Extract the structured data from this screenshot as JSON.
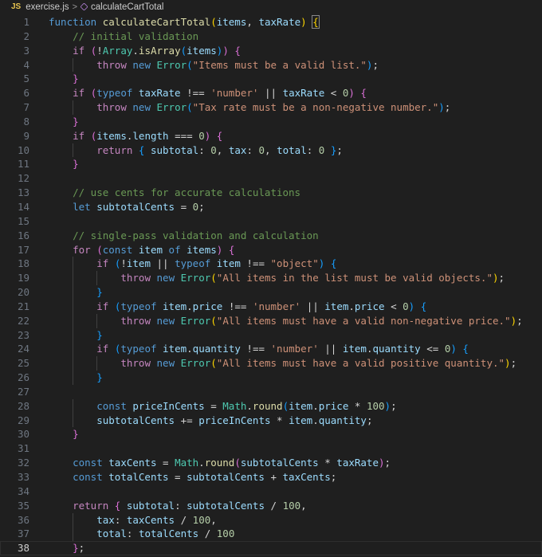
{
  "breadcrumb": {
    "file_badge": "JS",
    "file_name": "exercise.js",
    "separator": ">",
    "symbol_name": "calculateCartTotal"
  },
  "colors": {
    "background": "#1f1f1f",
    "keyword": "#569cd6",
    "control": "#c586c0",
    "function": "#dcdcaa",
    "variable": "#9cdcfe",
    "class": "#4ec9b0",
    "string": "#ce9178",
    "number": "#b5cea8",
    "comment": "#6a9955"
  },
  "editor": {
    "current_line": 38,
    "lines": [
      {
        "n": 1,
        "indent": 0,
        "t": [
          [
            "kw",
            "function "
          ],
          [
            "fn",
            "calculateCartTotal"
          ],
          [
            "br1",
            "("
          ],
          [
            "var",
            "items"
          ],
          [
            "op",
            ", "
          ],
          [
            "var",
            "taxRate"
          ],
          [
            "br1",
            ")"
          ],
          [
            "op",
            " "
          ],
          [
            "br1",
            "{"
          ]
        ]
      },
      {
        "n": 2,
        "indent": 1,
        "t": [
          [
            "cmt",
            "// initial validation"
          ]
        ]
      },
      {
        "n": 3,
        "indent": 1,
        "t": [
          [
            "ctl",
            "if "
          ],
          [
            "br2",
            "("
          ],
          [
            "op",
            "!"
          ],
          [
            "cls",
            "Array"
          ],
          [
            "op",
            "."
          ],
          [
            "fn",
            "isArray"
          ],
          [
            "br3",
            "("
          ],
          [
            "var",
            "items"
          ],
          [
            "br3",
            ")"
          ],
          [
            "br2",
            ")"
          ],
          [
            "op",
            " "
          ],
          [
            "br2",
            "{"
          ]
        ]
      },
      {
        "n": 4,
        "indent": 2,
        "t": [
          [
            "ctl",
            "throw "
          ],
          [
            "kw",
            "new "
          ],
          [
            "cls",
            "Error"
          ],
          [
            "br3",
            "("
          ],
          [
            "str",
            "\"Items must be a valid list.\""
          ],
          [
            "br3",
            ")"
          ],
          [
            "op",
            ";"
          ]
        ]
      },
      {
        "n": 5,
        "indent": 1,
        "t": [
          [
            "br2",
            "}"
          ]
        ]
      },
      {
        "n": 6,
        "indent": 1,
        "t": [
          [
            "ctl",
            "if "
          ],
          [
            "br2",
            "("
          ],
          [
            "kw",
            "typeof "
          ],
          [
            "var",
            "taxRate"
          ],
          [
            "op",
            " !== "
          ],
          [
            "str",
            "'number'"
          ],
          [
            "op",
            " || "
          ],
          [
            "var",
            "taxRate"
          ],
          [
            "op",
            " < "
          ],
          [
            "num",
            "0"
          ],
          [
            "br2",
            ")"
          ],
          [
            "op",
            " "
          ],
          [
            "br2",
            "{"
          ]
        ]
      },
      {
        "n": 7,
        "indent": 2,
        "t": [
          [
            "ctl",
            "throw "
          ],
          [
            "kw",
            "new "
          ],
          [
            "cls",
            "Error"
          ],
          [
            "br3",
            "("
          ],
          [
            "str",
            "\"Tax rate must be a non-negative number.\""
          ],
          [
            "br3",
            ")"
          ],
          [
            "op",
            ";"
          ]
        ]
      },
      {
        "n": 8,
        "indent": 1,
        "t": [
          [
            "br2",
            "}"
          ]
        ]
      },
      {
        "n": 9,
        "indent": 1,
        "t": [
          [
            "ctl",
            "if "
          ],
          [
            "br2",
            "("
          ],
          [
            "var",
            "items"
          ],
          [
            "op",
            "."
          ],
          [
            "var",
            "length"
          ],
          [
            "op",
            " === "
          ],
          [
            "num",
            "0"
          ],
          [
            "br2",
            ")"
          ],
          [
            "op",
            " "
          ],
          [
            "br2",
            "{"
          ]
        ]
      },
      {
        "n": 10,
        "indent": 2,
        "t": [
          [
            "ctl",
            "return "
          ],
          [
            "br3",
            "{"
          ],
          [
            "op",
            " "
          ],
          [
            "var",
            "subtotal"
          ],
          [
            "op",
            ": "
          ],
          [
            "num",
            "0"
          ],
          [
            "op",
            ", "
          ],
          [
            "var",
            "tax"
          ],
          [
            "op",
            ": "
          ],
          [
            "num",
            "0"
          ],
          [
            "op",
            ", "
          ],
          [
            "var",
            "total"
          ],
          [
            "op",
            ": "
          ],
          [
            "num",
            "0"
          ],
          [
            "op",
            " "
          ],
          [
            "br3",
            "}"
          ],
          [
            "op",
            ";"
          ]
        ]
      },
      {
        "n": 11,
        "indent": 1,
        "t": [
          [
            "br2",
            "}"
          ]
        ]
      },
      {
        "n": 12,
        "indent": 0,
        "t": []
      },
      {
        "n": 13,
        "indent": 1,
        "t": [
          [
            "cmt",
            "// use cents for accurate calculations"
          ]
        ]
      },
      {
        "n": 14,
        "indent": 1,
        "t": [
          [
            "kw",
            "let "
          ],
          [
            "var",
            "subtotalCents"
          ],
          [
            "op",
            " = "
          ],
          [
            "num",
            "0"
          ],
          [
            "op",
            ";"
          ]
        ]
      },
      {
        "n": 15,
        "indent": 0,
        "t": []
      },
      {
        "n": 16,
        "indent": 1,
        "t": [
          [
            "cmt",
            "// single-pass validation and calculation"
          ]
        ]
      },
      {
        "n": 17,
        "indent": 1,
        "t": [
          [
            "ctl",
            "for "
          ],
          [
            "br2",
            "("
          ],
          [
            "kw",
            "const "
          ],
          [
            "var",
            "item"
          ],
          [
            "kw",
            " of "
          ],
          [
            "var",
            "items"
          ],
          [
            "br2",
            ")"
          ],
          [
            "op",
            " "
          ],
          [
            "br2",
            "{"
          ]
        ]
      },
      {
        "n": 18,
        "indent": 2,
        "t": [
          [
            "ctl",
            "if "
          ],
          [
            "br3",
            "("
          ],
          [
            "op",
            "!"
          ],
          [
            "var",
            "item"
          ],
          [
            "op",
            " || "
          ],
          [
            "kw",
            "typeof "
          ],
          [
            "var",
            "item"
          ],
          [
            "op",
            " !== "
          ],
          [
            "str",
            "\"object\""
          ],
          [
            "br3",
            ")"
          ],
          [
            "op",
            " "
          ],
          [
            "br3",
            "{"
          ]
        ]
      },
      {
        "n": 19,
        "indent": 3,
        "t": [
          [
            "ctl",
            "throw "
          ],
          [
            "kw",
            "new "
          ],
          [
            "cls",
            "Error"
          ],
          [
            "br1",
            "("
          ],
          [
            "str",
            "\"All items in the list must be valid objects.\""
          ],
          [
            "br1",
            ")"
          ],
          [
            "op",
            ";"
          ]
        ]
      },
      {
        "n": 20,
        "indent": 2,
        "t": [
          [
            "br3",
            "}"
          ]
        ]
      },
      {
        "n": 21,
        "indent": 2,
        "t": [
          [
            "ctl",
            "if "
          ],
          [
            "br3",
            "("
          ],
          [
            "kw",
            "typeof "
          ],
          [
            "var",
            "item"
          ],
          [
            "op",
            "."
          ],
          [
            "var",
            "price"
          ],
          [
            "op",
            " !== "
          ],
          [
            "str",
            "'number'"
          ],
          [
            "op",
            " || "
          ],
          [
            "var",
            "item"
          ],
          [
            "op",
            "."
          ],
          [
            "var",
            "price"
          ],
          [
            "op",
            " < "
          ],
          [
            "num",
            "0"
          ],
          [
            "br3",
            ")"
          ],
          [
            "op",
            " "
          ],
          [
            "br3",
            "{"
          ]
        ]
      },
      {
        "n": 22,
        "indent": 3,
        "t": [
          [
            "ctl",
            "throw "
          ],
          [
            "kw",
            "new "
          ],
          [
            "cls",
            "Error"
          ],
          [
            "br1",
            "("
          ],
          [
            "str",
            "\"All items must have a valid non-negative price.\""
          ],
          [
            "br1",
            ")"
          ],
          [
            "op",
            ";"
          ]
        ]
      },
      {
        "n": 23,
        "indent": 2,
        "t": [
          [
            "br3",
            "}"
          ]
        ]
      },
      {
        "n": 24,
        "indent": 2,
        "t": [
          [
            "ctl",
            "if "
          ],
          [
            "br3",
            "("
          ],
          [
            "kw",
            "typeof "
          ],
          [
            "var",
            "item"
          ],
          [
            "op",
            "."
          ],
          [
            "var",
            "quantity"
          ],
          [
            "op",
            " !== "
          ],
          [
            "str",
            "'number'"
          ],
          [
            "op",
            " || "
          ],
          [
            "var",
            "item"
          ],
          [
            "op",
            "."
          ],
          [
            "var",
            "quantity"
          ],
          [
            "op",
            " <= "
          ],
          [
            "num",
            "0"
          ],
          [
            "br3",
            ")"
          ],
          [
            "op",
            " "
          ],
          [
            "br3",
            "{"
          ]
        ]
      },
      {
        "n": 25,
        "indent": 3,
        "t": [
          [
            "ctl",
            "throw "
          ],
          [
            "kw",
            "new "
          ],
          [
            "cls",
            "Error"
          ],
          [
            "br1",
            "("
          ],
          [
            "str",
            "\"All items must have a valid positive quantity.\""
          ],
          [
            "br1",
            ")"
          ],
          [
            "op",
            ";"
          ]
        ]
      },
      {
        "n": 26,
        "indent": 2,
        "t": [
          [
            "br3",
            "}"
          ]
        ]
      },
      {
        "n": 27,
        "indent": 0,
        "t": []
      },
      {
        "n": 28,
        "indent": 2,
        "t": [
          [
            "kw",
            "const "
          ],
          [
            "var",
            "priceInCents"
          ],
          [
            "op",
            " = "
          ],
          [
            "cls",
            "Math"
          ],
          [
            "op",
            "."
          ],
          [
            "fn",
            "round"
          ],
          [
            "br3",
            "("
          ],
          [
            "var",
            "item"
          ],
          [
            "op",
            "."
          ],
          [
            "var",
            "price"
          ],
          [
            "op",
            " * "
          ],
          [
            "num",
            "100"
          ],
          [
            "br3",
            ")"
          ],
          [
            "op",
            ";"
          ]
        ]
      },
      {
        "n": 29,
        "indent": 2,
        "t": [
          [
            "var",
            "subtotalCents"
          ],
          [
            "op",
            " += "
          ],
          [
            "var",
            "priceInCents"
          ],
          [
            "op",
            " * "
          ],
          [
            "var",
            "item"
          ],
          [
            "op",
            "."
          ],
          [
            "var",
            "quantity"
          ],
          [
            "op",
            ";"
          ]
        ]
      },
      {
        "n": 30,
        "indent": 1,
        "t": [
          [
            "br2",
            "}"
          ]
        ]
      },
      {
        "n": 31,
        "indent": 0,
        "t": []
      },
      {
        "n": 32,
        "indent": 1,
        "t": [
          [
            "kw",
            "const "
          ],
          [
            "var",
            "taxCents"
          ],
          [
            "op",
            " = "
          ],
          [
            "cls",
            "Math"
          ],
          [
            "op",
            "."
          ],
          [
            "fn",
            "round"
          ],
          [
            "br2",
            "("
          ],
          [
            "var",
            "subtotalCents"
          ],
          [
            "op",
            " * "
          ],
          [
            "var",
            "taxRate"
          ],
          [
            "br2",
            ")"
          ],
          [
            "op",
            ";"
          ]
        ]
      },
      {
        "n": 33,
        "indent": 1,
        "t": [
          [
            "kw",
            "const "
          ],
          [
            "var",
            "totalCents"
          ],
          [
            "op",
            " = "
          ],
          [
            "var",
            "subtotalCents"
          ],
          [
            "op",
            " + "
          ],
          [
            "var",
            "taxCents"
          ],
          [
            "op",
            ";"
          ]
        ]
      },
      {
        "n": 34,
        "indent": 0,
        "t": []
      },
      {
        "n": 35,
        "indent": 1,
        "t": [
          [
            "ctl",
            "return "
          ],
          [
            "br2",
            "{"
          ],
          [
            "op",
            " "
          ],
          [
            "var",
            "subtotal"
          ],
          [
            "op",
            ": "
          ],
          [
            "var",
            "subtotalCents"
          ],
          [
            "op",
            " / "
          ],
          [
            "num",
            "100"
          ],
          [
            "op",
            ","
          ]
        ]
      },
      {
        "n": 36,
        "indent": 2,
        "t": [
          [
            "var",
            "tax"
          ],
          [
            "op",
            ": "
          ],
          [
            "var",
            "taxCents"
          ],
          [
            "op",
            " / "
          ],
          [
            "num",
            "100"
          ],
          [
            "op",
            ","
          ]
        ]
      },
      {
        "n": 37,
        "indent": 2,
        "t": [
          [
            "var",
            "total"
          ],
          [
            "op",
            ": "
          ],
          [
            "var",
            "totalCents"
          ],
          [
            "op",
            " / "
          ],
          [
            "num",
            "100"
          ]
        ]
      },
      {
        "n": 38,
        "indent": 1,
        "t": [
          [
            "br2",
            "}"
          ],
          [
            "op",
            ";"
          ]
        ]
      }
    ]
  }
}
